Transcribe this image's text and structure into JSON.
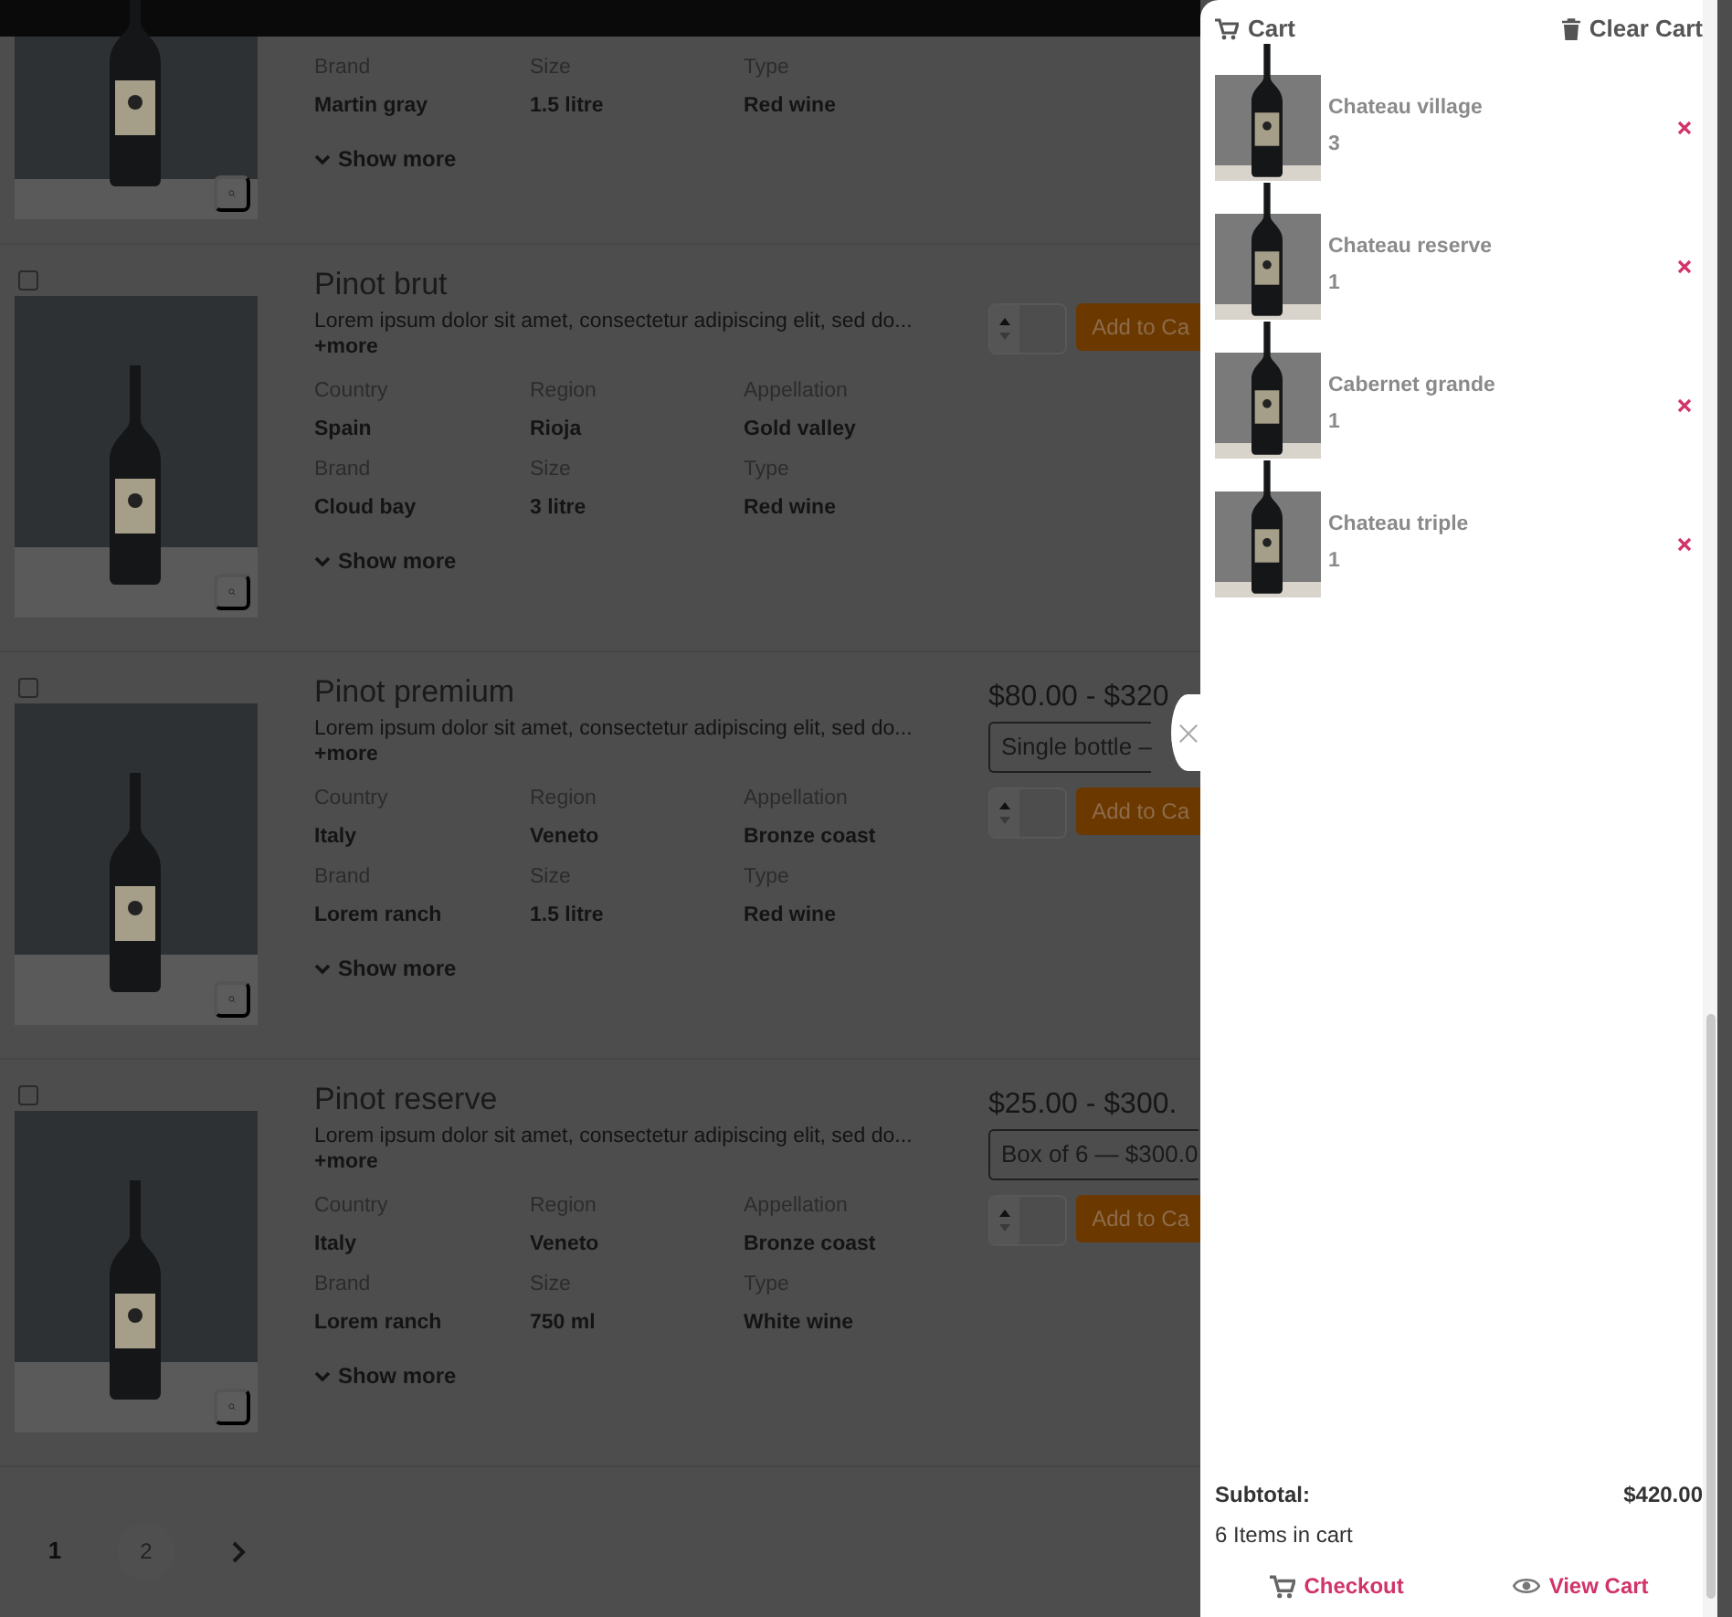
{
  "products": [
    {
      "attributes": [
        {
          "label": "Brand",
          "value": "Martin gray"
        },
        {
          "label": "Size",
          "value": "1.5 litre"
        },
        {
          "label": "Type",
          "value": "Red wine"
        }
      ],
      "show_more": "Show more"
    },
    {
      "checked": false,
      "title": "Pinot brut",
      "description": "Lorem ipsum dolor sit amet, consectetur adipiscing elit, sed do...",
      "more_link": "+more",
      "attributes": [
        {
          "label": "Country",
          "value": "Spain"
        },
        {
          "label": "Region",
          "value": "Rioja"
        },
        {
          "label": "Appellation",
          "value": "Gold valley"
        },
        {
          "label": "Brand",
          "value": "Cloud bay"
        },
        {
          "label": "Size",
          "value": "3 litre"
        },
        {
          "label": "Type",
          "value": "Red wine"
        }
      ],
      "show_more": "Show more",
      "add_button": "Add to Ca"
    },
    {
      "checked": false,
      "title": "Pinot premium",
      "description": "Lorem ipsum dolor sit amet, consectetur adipiscing elit, sed do...",
      "more_link": "+more",
      "attributes": [
        {
          "label": "Country",
          "value": "Italy"
        },
        {
          "label": "Region",
          "value": "Veneto"
        },
        {
          "label": "Appellation",
          "value": "Bronze coast"
        },
        {
          "label": "Brand",
          "value": "Lorem ranch"
        },
        {
          "label": "Size",
          "value": "1.5 litre"
        },
        {
          "label": "Type",
          "value": "Red wine"
        }
      ],
      "show_more": "Show more",
      "price": "$80.00 - $320",
      "option": "Single bottle –",
      "add_button": "Add to Ca"
    },
    {
      "checked": false,
      "title": "Pinot reserve",
      "description": "Lorem ipsum dolor sit amet, consectetur adipiscing elit, sed do...",
      "more_link": "+more",
      "attributes": [
        {
          "label": "Country",
          "value": "Italy"
        },
        {
          "label": "Region",
          "value": "Veneto"
        },
        {
          "label": "Appellation",
          "value": "Bronze coast"
        },
        {
          "label": "Brand",
          "value": "Lorem ranch"
        },
        {
          "label": "Size",
          "value": "750 ml"
        },
        {
          "label": "Type",
          "value": "White wine"
        }
      ],
      "show_more": "Show more",
      "price": "$25.00 - $300.",
      "option": "Box of 6 — $300.0",
      "add_button": "Add to Ca"
    }
  ],
  "pagination": [
    {
      "label": "1",
      "selected": true
    },
    {
      "label": "2",
      "selected": false
    }
  ],
  "cart": {
    "title": "Cart",
    "clear": "Clear Cart",
    "items": [
      {
        "name": "Chateau village",
        "quantity": "3"
      },
      {
        "name": "Chateau reserve",
        "quantity": "1"
      },
      {
        "name": "Cabernet grande",
        "quantity": "1"
      },
      {
        "name": "Chateau triple",
        "quantity": "1"
      }
    ],
    "subtotal_label": "Subtotal:",
    "subtotal": "$420.00",
    "count": "6 Items in cart",
    "checkout": "Checkout",
    "view_cart": "View Cart"
  }
}
